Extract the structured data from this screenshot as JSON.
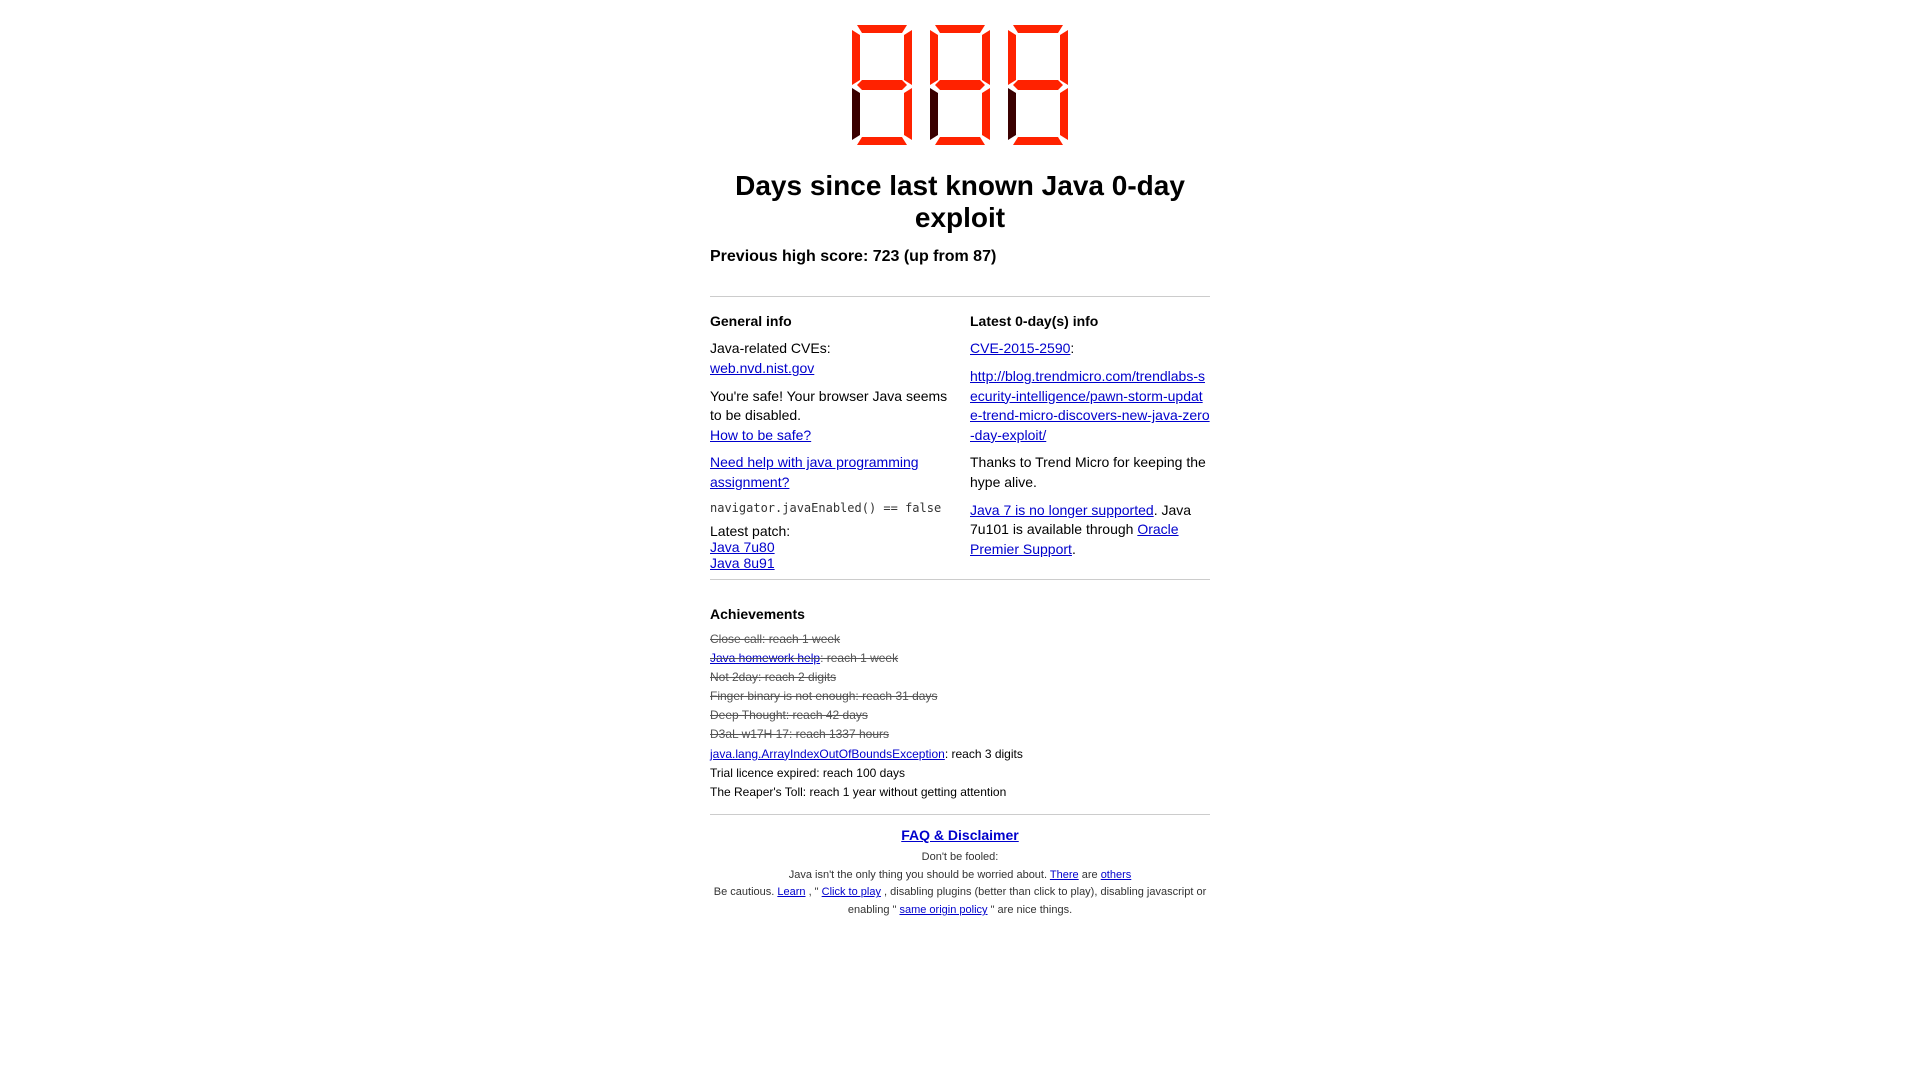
{
  "counter": {
    "digits": [
      "9",
      "9",
      "9"
    ],
    "alt_text": "999"
  },
  "heading": {
    "title": "Days since last known Java 0-day exploit"
  },
  "previous_score": {
    "text": "Previous high score: 723 (up from 87)"
  },
  "general_info": {
    "header": "General info",
    "cve_text": "Java-related CVEs:",
    "cve_link_text": "web.nvd.nist.gov",
    "cve_link_href": "https://web.nvd.nist.gov",
    "browser_text": "You're safe! Your browser Java seems to be disabled.",
    "how_safe_link": "How to be safe?",
    "how_safe_href": "#",
    "need_help_link": "Need help with java programming assignment?",
    "need_help_href": "#",
    "code_text": "navigator.javaEnabled() == false",
    "latest_patch_label": "Latest patch:",
    "java_7u80_link": "Java 7u80",
    "java_7u80_href": "#",
    "java_8u91_link": "Java 8u91",
    "java_8u91_href": "#"
  },
  "latest_zeroday": {
    "header": "Latest 0-day(s) info",
    "cve_link": "CVE-2015-2590",
    "cve_href": "#",
    "blog_url_text": "http://blog.trendmicro.com/trendlabs-security-intelligence/pawn-storm-update-trend-micro-discovers-new-java-zero-day-exploit/",
    "blog_href": "http://blog.trendmicro.com/trendlabs-security-intelligence/pawn-storm-update-trend-micro-discovers-new-java-zero-day-exploit/",
    "thanks_text": "Thanks to Trend Micro for keeping the hype alive.",
    "java7_support_link": "Java 7 is no longer supported",
    "java7_href": "#",
    "java7_text": ". Java 7u101 is available through ",
    "oracle_link": "Oracle Premier Support",
    "oracle_href": "#",
    "oracle_suffix": "."
  },
  "achievements": {
    "header": "Achievements",
    "items": [
      {
        "text": "Close call: reach 1 week",
        "strikethrough": true,
        "link": null
      },
      {
        "text": "Java homework help: reach 1 week",
        "strikethrough": true,
        "link": "Java homework help"
      },
      {
        "text": "Not 2day: reach 2 digits",
        "strikethrough": true,
        "link": null
      },
      {
        "text": "Finger binary is not enough: reach 31 days",
        "strikethrough": true,
        "link": null
      },
      {
        "text": "Deep Thought: reach 42 days",
        "strikethrough": true,
        "link": null
      },
      {
        "text": "D3aL w17H 17: reach 1337 hours",
        "strikethrough": true,
        "link": null
      },
      {
        "text": "java.lang.ArrayIndexOutOfBoundsException: reach 3 digits",
        "strikethrough": false,
        "link": "java.lang.ArrayIndexOutOfBoundsException"
      },
      {
        "text": "Trial licence expired: reach 100 days",
        "strikethrough": false,
        "link": null
      },
      {
        "text": "The Reaper's Toll: reach 1 year without getting attention",
        "strikethrough": false,
        "link": null
      }
    ]
  },
  "footer": {
    "faq_link": "FAQ & Disclaimer",
    "faq_href": "#",
    "dont_be_fooled": "Don't be fooled:",
    "java_not_only": "Java isn't the only thing you should be worried about.",
    "there_link": "There",
    "there_href": "#",
    "others_link": "others",
    "others_href": "#",
    "be_cautious": "Be cautious.",
    "learn_link": "Learn",
    "learn_href": "#",
    "click_to_play_link": "Click to play",
    "click_to_play_href": "#",
    "disabling_text": ", disabling plugins (better than click to play), disabling javascript or enabling \"",
    "same_origin_link": "same origin policy",
    "same_origin_href": "#",
    "nice_things_text": "\" are nice things."
  }
}
